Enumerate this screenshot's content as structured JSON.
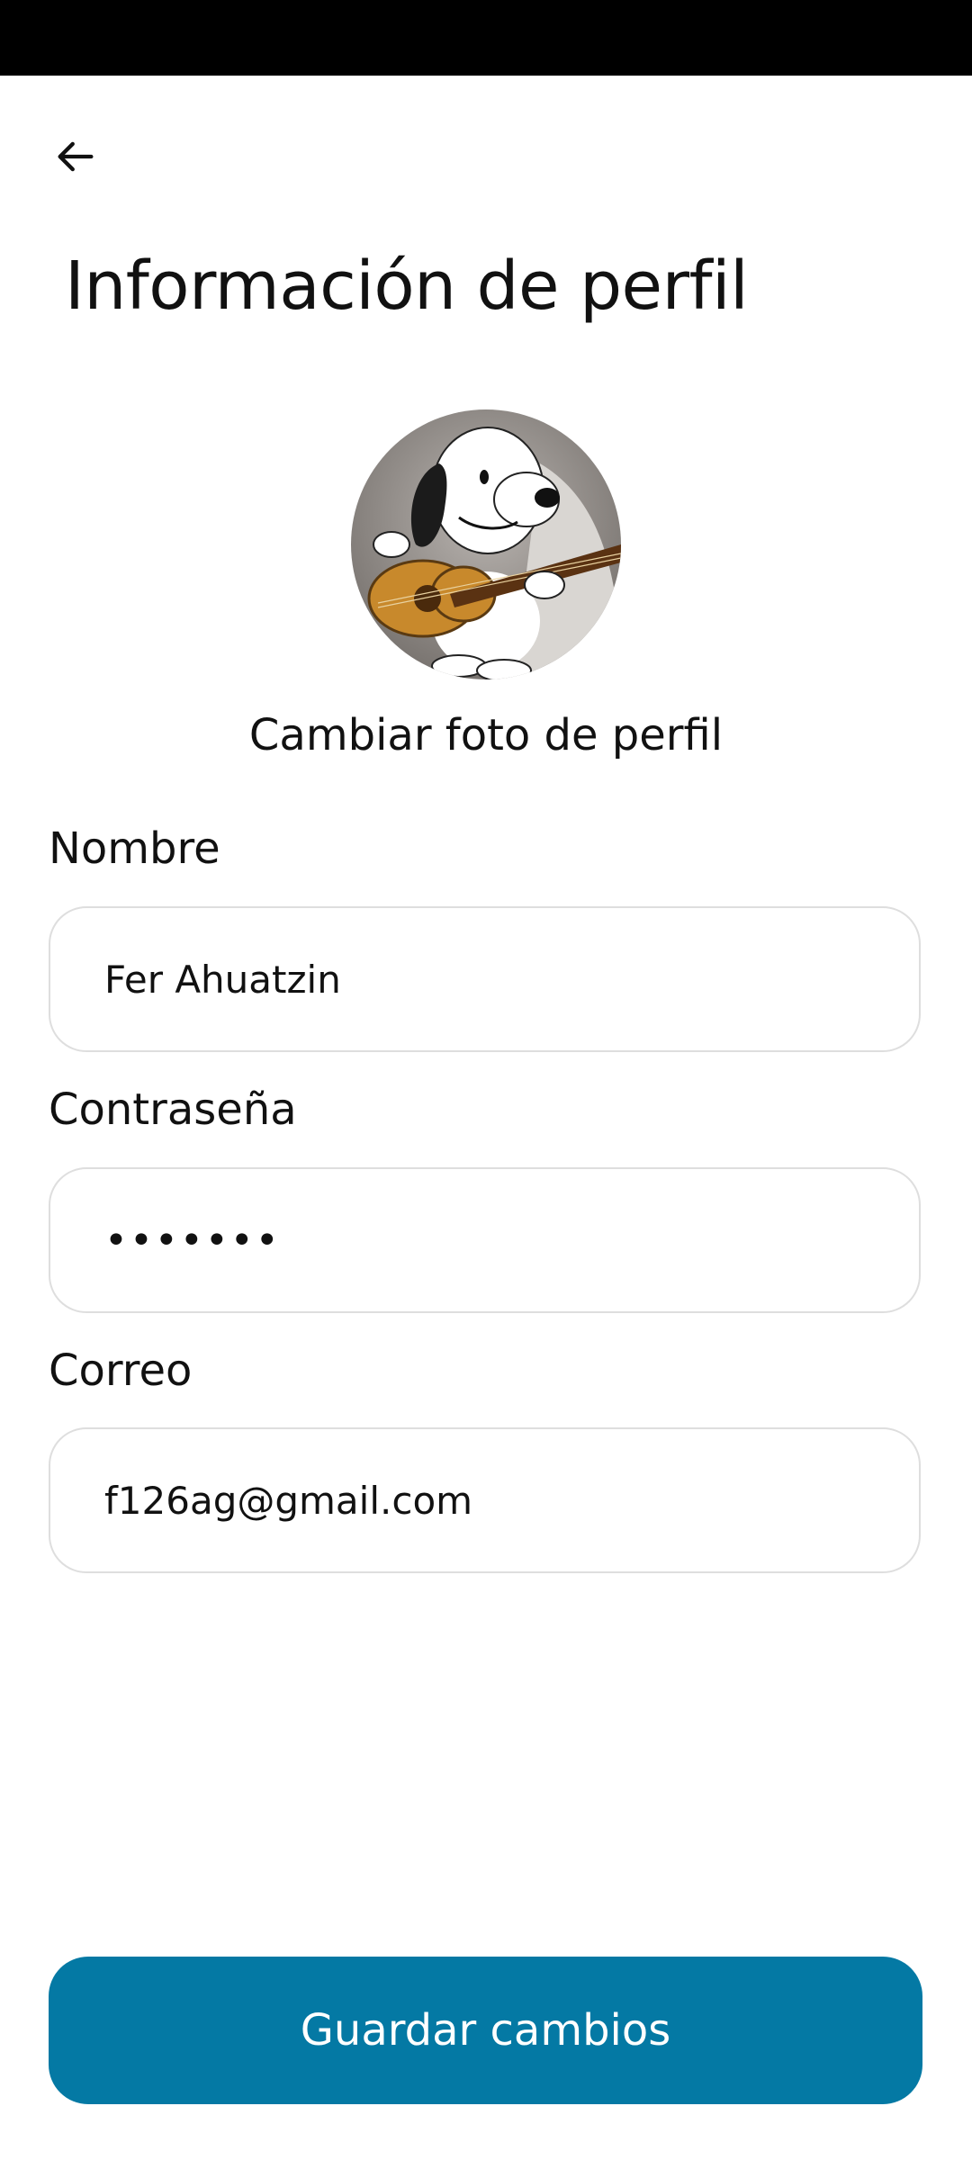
{
  "header": {
    "back_icon": "arrow-left-icon",
    "title": "Información de perfil"
  },
  "profile": {
    "avatar_icon": "profile-photo",
    "change_photo_label": "Cambiar foto de perfil"
  },
  "form": {
    "name": {
      "label": "Nombre",
      "value": "Fer Ahuatzin"
    },
    "password": {
      "label": "Contraseña",
      "value": "•••••••"
    },
    "email": {
      "label": "Correo",
      "value": "f126ag@gmail.com"
    }
  },
  "actions": {
    "save_label": "Guardar cambios"
  },
  "colors": {
    "accent": "#0479a4",
    "status_bar": "#000000",
    "input_border": "#dedede"
  }
}
